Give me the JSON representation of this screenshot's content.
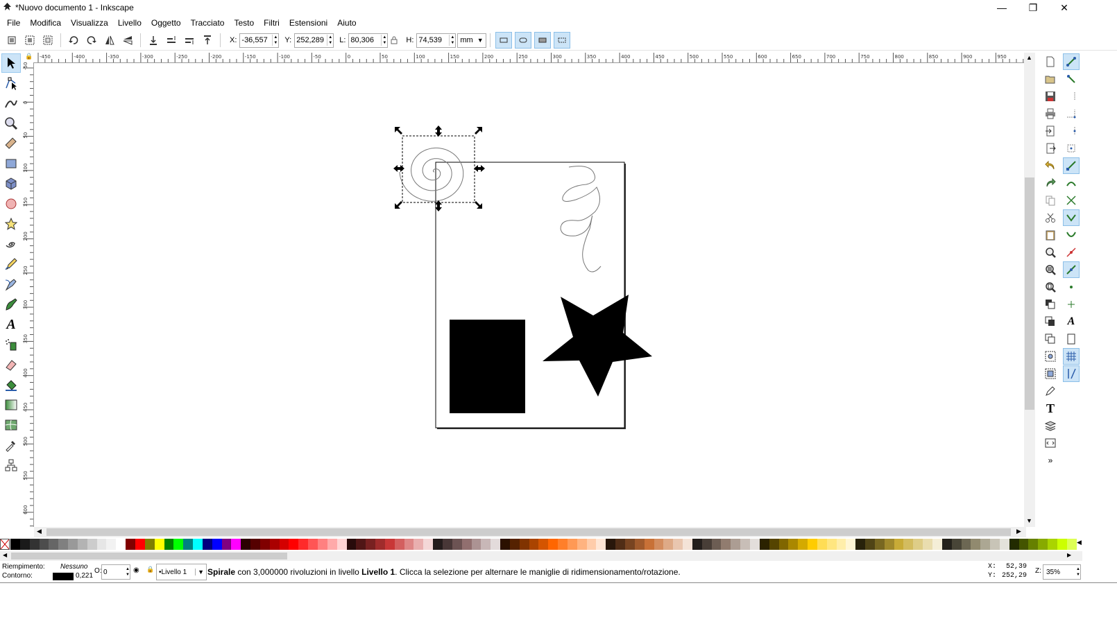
{
  "window": {
    "title": "*Nuovo documento 1 - Inkscape",
    "controls": {
      "minimize": "—",
      "maximize": "❐",
      "close": "✕"
    }
  },
  "menu": [
    {
      "label": "File"
    },
    {
      "label": "Modifica"
    },
    {
      "label": "Visualizza"
    },
    {
      "label": "Livello"
    },
    {
      "label": "Oggetto"
    },
    {
      "label": "Tracciato"
    },
    {
      "label": "Testo"
    },
    {
      "label": "Filtri"
    },
    {
      "label": "Estensioni"
    },
    {
      "label": "Aiuto"
    }
  ],
  "toolbar": {
    "x_label": "X:",
    "x_value": "-36,557",
    "y_label": "Y:",
    "y_value": "252,289",
    "w_label": "L:",
    "w_value": "80,306",
    "h_label": "H:",
    "h_value": "74,539",
    "unit": "mm"
  },
  "rulers": {
    "horizontal_ticks": [
      "-450",
      "-400",
      "-350",
      "-300",
      "-250",
      "-200",
      "-150",
      "-100",
      "-50",
      "0",
      "50",
      "100",
      "150",
      "200",
      "250",
      "300",
      "350",
      "400",
      "450",
      "500",
      "550",
      "600",
      "650",
      "700",
      "750",
      "800",
      "850",
      "900",
      "950"
    ],
    "vertical_ticks": [
      "-50",
      "0",
      "50",
      "100",
      "150",
      "200",
      "250",
      "300",
      "350",
      "400",
      "450",
      "500",
      "550",
      "600",
      "650"
    ]
  },
  "statusbar": {
    "fill_label": "Riempimento:",
    "fill_value": "Nessuno",
    "stroke_label": "Contorno:",
    "stroke_width": "0,221",
    "opacity_label": "O:",
    "opacity_value": "0",
    "layer": "•Livello 1",
    "message_bold_1": "Spirale",
    "message_mid": " con 3,000000 rivoluzioni in livello ",
    "message_bold_2": "Livello 1",
    "message_end": ". Clicca la selezione per alternare le maniglie di ridimensionamento/rotazione.",
    "cursor_x_label": "X:",
    "cursor_x": "52,39",
    "cursor_y_label": "Y:",
    "cursor_y": "252,29",
    "zoom_label": "Z:",
    "zoom": "35%"
  },
  "colors": {
    "accent": "#cce4f7",
    "selection_arrows": "#000000"
  },
  "palette": [
    "#000000",
    "#1a1a1a",
    "#333333",
    "#4d4d4d",
    "#666666",
    "#808080",
    "#999999",
    "#b3b3b3",
    "#cccccc",
    "#e6e6e6",
    "#f2f2f2",
    "#ffffff",
    "#800000",
    "#ff0000",
    "#808000",
    "#ffff00",
    "#008000",
    "#00ff00",
    "#008080",
    "#00ffff",
    "#000080",
    "#0000ff",
    "#800080",
    "#ff00ff",
    "#2b0000",
    "#550000",
    "#800000",
    "#aa0000",
    "#d40000",
    "#ff0000",
    "#ff2a2a",
    "#ff5555",
    "#ff8080",
    "#ffaaaa",
    "#ffd5d5",
    "#280b0b",
    "#501616",
    "#782121",
    "#a02c2c",
    "#c83737",
    "#d35f5f",
    "#de8787",
    "#e9afaf",
    "#f4d7d7",
    "#241c1c",
    "#483737",
    "#6c5353",
    "#916f6f",
    "#ac9393",
    "#c8b7b7",
    "#e3dbdb",
    "#2b1100",
    "#552200",
    "#803300",
    "#aa4400",
    "#d45500",
    "#ff6600",
    "#ff7f2a",
    "#ff9955",
    "#ffb380",
    "#ffccaa",
    "#ffe6d5",
    "#28170b",
    "#502d16",
    "#784421",
    "#a05a2c",
    "#c87137",
    "#d38d5f",
    "#deaa87",
    "#e9c6af",
    "#f4e3d7",
    "#241f1c",
    "#483e37",
    "#6c5d53",
    "#917c6f",
    "#ac9d93",
    "#c8beb7",
    "#e3dedb",
    "#2b2200",
    "#554400",
    "#806600",
    "#aa8800",
    "#d4aa00",
    "#ffcc00",
    "#ffdd55",
    "#ffe680",
    "#ffeeaa",
    "#fff6d5",
    "#28220b",
    "#504416",
    "#786721",
    "#a0892c",
    "#c8ab37",
    "#d3bc5f",
    "#decd87",
    "#e9ddaf",
    "#f4eed7",
    "#24221c",
    "#484537",
    "#6c6753",
    "#918a6f",
    "#aca793",
    "#c8c4b7",
    "#e3e2db",
    "#222b00",
    "#445500",
    "#668000",
    "#88aa00",
    "#aad400",
    "#ccff00",
    "#ddff55"
  ]
}
